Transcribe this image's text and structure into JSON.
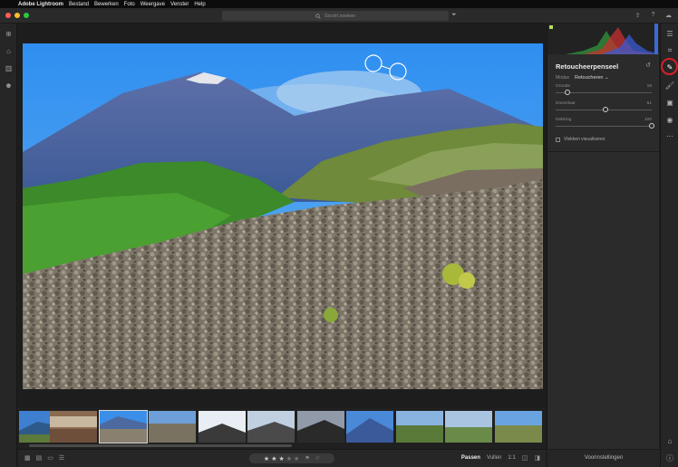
{
  "menubar": {
    "app_name": "Adobe Lightroom",
    "items": [
      "Bestand",
      "Bewerken",
      "Foto",
      "Weergave",
      "Venster",
      "Help"
    ]
  },
  "search": {
    "placeholder": "Sociël zoeken"
  },
  "colors": {
    "close": "#ff5f57",
    "minimize": "#febc2e",
    "zoom": "#28c840",
    "highlight_ring": "#d81f26",
    "panel_bg": "#2b2b2b"
  },
  "icons": {
    "left_rail": [
      "add-photos-icon",
      "home-icon",
      "library-icon",
      "people-icon"
    ],
    "right_rail": [
      "edit-panel-icon",
      "crop-icon",
      "healing-brush-icon",
      "brush-icon",
      "linear-gradient-icon",
      "radial-gradient-icon",
      "more-icon",
      "tag-icon",
      "info-icon"
    ]
  },
  "panel": {
    "title": "Retoucheerpenseel",
    "modus_label": "Modus",
    "modus_value": "Retoucheren",
    "sliders": [
      {
        "label": "Grootte",
        "value": "18",
        "fraction": 0.12
      },
      {
        "label": "Doezelaar",
        "value": "51",
        "fraction": 0.52
      },
      {
        "label": "Dekking",
        "value": "100",
        "fraction": 1.0
      }
    ],
    "visualize_label": "Vlekken visualiseren",
    "presets_button": "Voorinstellingen"
  },
  "bottombar": {
    "fit_label": "Passen",
    "fill_label": "Vullen",
    "ratio_label": "1:1",
    "rating": 3,
    "rating_max": 5
  },
  "filmstrip": {
    "count": 11,
    "selected_index": 2
  }
}
